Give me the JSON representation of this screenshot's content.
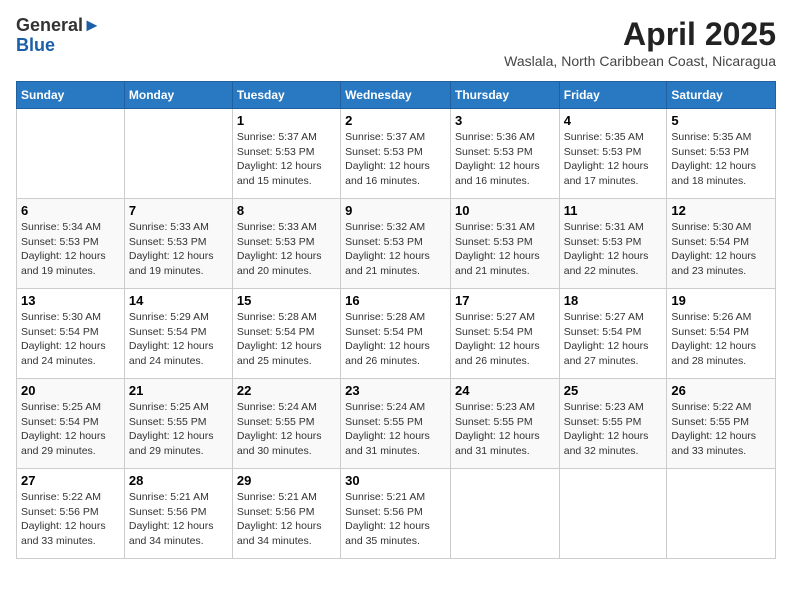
{
  "logo": {
    "general": "General",
    "blue": "Blue"
  },
  "title": "April 2025",
  "subtitle": "Waslala, North Caribbean Coast, Nicaragua",
  "days_of_week": [
    "Sunday",
    "Monday",
    "Tuesday",
    "Wednesday",
    "Thursday",
    "Friday",
    "Saturday"
  ],
  "weeks": [
    [
      {
        "num": "",
        "info": ""
      },
      {
        "num": "",
        "info": ""
      },
      {
        "num": "1",
        "info": "Sunrise: 5:37 AM\nSunset: 5:53 PM\nDaylight: 12 hours and 15 minutes."
      },
      {
        "num": "2",
        "info": "Sunrise: 5:37 AM\nSunset: 5:53 PM\nDaylight: 12 hours and 16 minutes."
      },
      {
        "num": "3",
        "info": "Sunrise: 5:36 AM\nSunset: 5:53 PM\nDaylight: 12 hours and 16 minutes."
      },
      {
        "num": "4",
        "info": "Sunrise: 5:35 AM\nSunset: 5:53 PM\nDaylight: 12 hours and 17 minutes."
      },
      {
        "num": "5",
        "info": "Sunrise: 5:35 AM\nSunset: 5:53 PM\nDaylight: 12 hours and 18 minutes."
      }
    ],
    [
      {
        "num": "6",
        "info": "Sunrise: 5:34 AM\nSunset: 5:53 PM\nDaylight: 12 hours and 19 minutes."
      },
      {
        "num": "7",
        "info": "Sunrise: 5:33 AM\nSunset: 5:53 PM\nDaylight: 12 hours and 19 minutes."
      },
      {
        "num": "8",
        "info": "Sunrise: 5:33 AM\nSunset: 5:53 PM\nDaylight: 12 hours and 20 minutes."
      },
      {
        "num": "9",
        "info": "Sunrise: 5:32 AM\nSunset: 5:53 PM\nDaylight: 12 hours and 21 minutes."
      },
      {
        "num": "10",
        "info": "Sunrise: 5:31 AM\nSunset: 5:53 PM\nDaylight: 12 hours and 21 minutes."
      },
      {
        "num": "11",
        "info": "Sunrise: 5:31 AM\nSunset: 5:53 PM\nDaylight: 12 hours and 22 minutes."
      },
      {
        "num": "12",
        "info": "Sunrise: 5:30 AM\nSunset: 5:54 PM\nDaylight: 12 hours and 23 minutes."
      }
    ],
    [
      {
        "num": "13",
        "info": "Sunrise: 5:30 AM\nSunset: 5:54 PM\nDaylight: 12 hours and 24 minutes."
      },
      {
        "num": "14",
        "info": "Sunrise: 5:29 AM\nSunset: 5:54 PM\nDaylight: 12 hours and 24 minutes."
      },
      {
        "num": "15",
        "info": "Sunrise: 5:28 AM\nSunset: 5:54 PM\nDaylight: 12 hours and 25 minutes."
      },
      {
        "num": "16",
        "info": "Sunrise: 5:28 AM\nSunset: 5:54 PM\nDaylight: 12 hours and 26 minutes."
      },
      {
        "num": "17",
        "info": "Sunrise: 5:27 AM\nSunset: 5:54 PM\nDaylight: 12 hours and 26 minutes."
      },
      {
        "num": "18",
        "info": "Sunrise: 5:27 AM\nSunset: 5:54 PM\nDaylight: 12 hours and 27 minutes."
      },
      {
        "num": "19",
        "info": "Sunrise: 5:26 AM\nSunset: 5:54 PM\nDaylight: 12 hours and 28 minutes."
      }
    ],
    [
      {
        "num": "20",
        "info": "Sunrise: 5:25 AM\nSunset: 5:54 PM\nDaylight: 12 hours and 29 minutes."
      },
      {
        "num": "21",
        "info": "Sunrise: 5:25 AM\nSunset: 5:55 PM\nDaylight: 12 hours and 29 minutes."
      },
      {
        "num": "22",
        "info": "Sunrise: 5:24 AM\nSunset: 5:55 PM\nDaylight: 12 hours and 30 minutes."
      },
      {
        "num": "23",
        "info": "Sunrise: 5:24 AM\nSunset: 5:55 PM\nDaylight: 12 hours and 31 minutes."
      },
      {
        "num": "24",
        "info": "Sunrise: 5:23 AM\nSunset: 5:55 PM\nDaylight: 12 hours and 31 minutes."
      },
      {
        "num": "25",
        "info": "Sunrise: 5:23 AM\nSunset: 5:55 PM\nDaylight: 12 hours and 32 minutes."
      },
      {
        "num": "26",
        "info": "Sunrise: 5:22 AM\nSunset: 5:55 PM\nDaylight: 12 hours and 33 minutes."
      }
    ],
    [
      {
        "num": "27",
        "info": "Sunrise: 5:22 AM\nSunset: 5:56 PM\nDaylight: 12 hours and 33 minutes."
      },
      {
        "num": "28",
        "info": "Sunrise: 5:21 AM\nSunset: 5:56 PM\nDaylight: 12 hours and 34 minutes."
      },
      {
        "num": "29",
        "info": "Sunrise: 5:21 AM\nSunset: 5:56 PM\nDaylight: 12 hours and 34 minutes."
      },
      {
        "num": "30",
        "info": "Sunrise: 5:21 AM\nSunset: 5:56 PM\nDaylight: 12 hours and 35 minutes."
      },
      {
        "num": "",
        "info": ""
      },
      {
        "num": "",
        "info": ""
      },
      {
        "num": "",
        "info": ""
      }
    ]
  ]
}
